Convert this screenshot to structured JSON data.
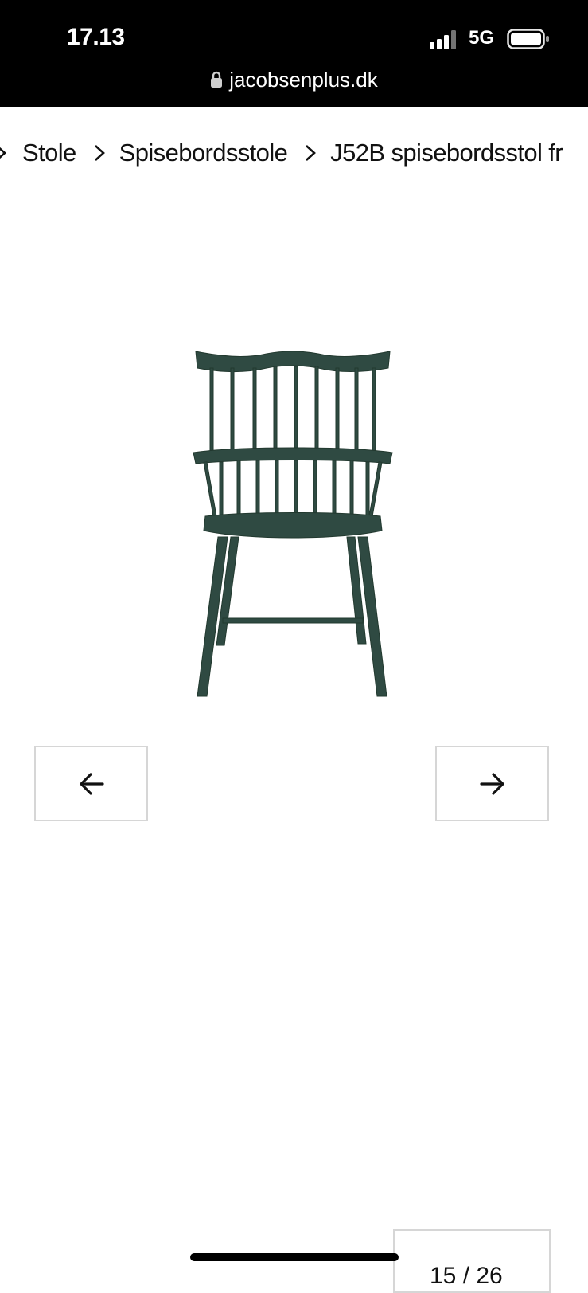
{
  "status_bar": {
    "time": "17.13",
    "network": "5G",
    "url": "jacobsenplus.dk"
  },
  "breadcrumb": {
    "items": [
      "Stole",
      "Spisebordsstole",
      "J52B spisebordsstol fr"
    ]
  },
  "product": {
    "image_icon": "green-windsor-chair",
    "color": "#2f4a42"
  },
  "gallery": {
    "prev_icon": "arrow-left-icon",
    "next_icon": "arrow-right-icon",
    "counter": "15 / 26"
  }
}
